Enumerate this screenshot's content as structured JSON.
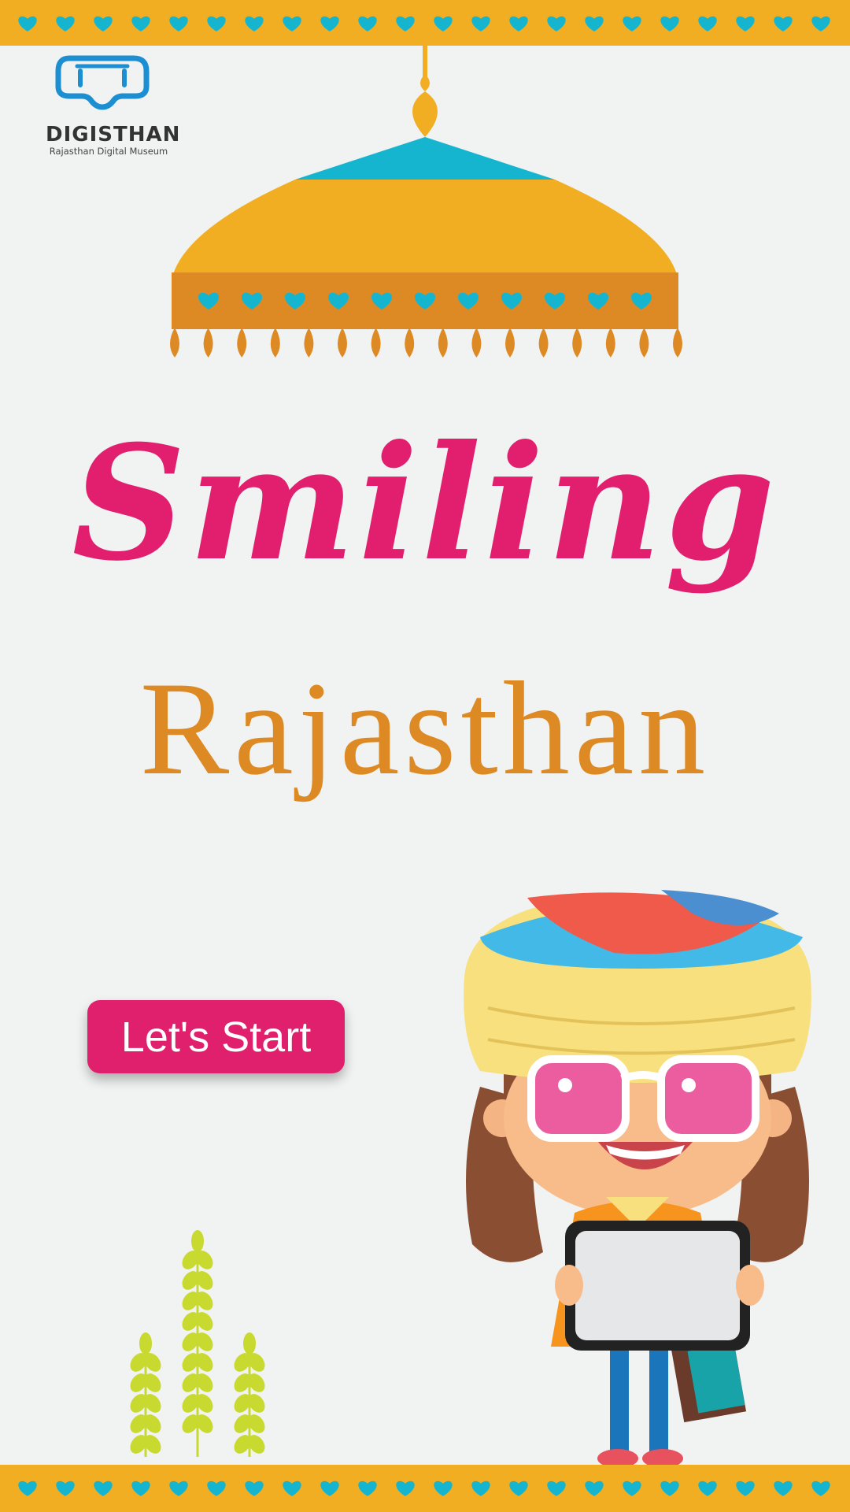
{
  "logo": {
    "wordmark": "DIGISTHAN",
    "subtitle": "Rajasthan Digital Museum"
  },
  "title": {
    "line1": "Smiling",
    "line2": "Rajasthan"
  },
  "start_button": {
    "label": "Let's Start"
  },
  "decor": {
    "border_icon": "heart-icon",
    "plant_icon": "wheat-plant-icon",
    "canopy_icon": "canopy-chhatri-icon",
    "character_icon": "rajasthani-girl-illustration"
  },
  "colors": {
    "band": "#f2ae23",
    "heart": "#15b5cf",
    "background": "#f1f2f2",
    "title_pink": "#e21f6e",
    "title_orange": "#dd8a25",
    "button": "#e01f6d"
  }
}
